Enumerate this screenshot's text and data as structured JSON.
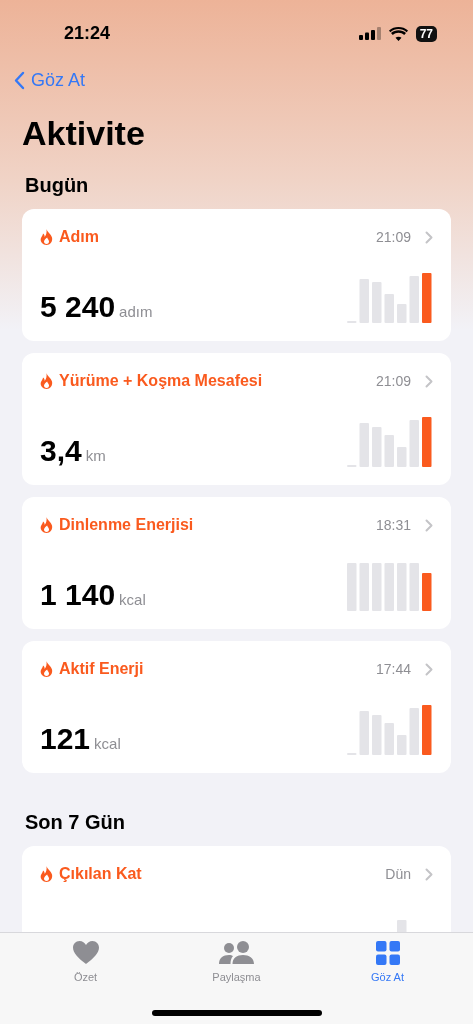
{
  "status_bar": {
    "time": "21:24",
    "battery": "77"
  },
  "nav": {
    "back": "Göz At",
    "title": "Aktivite"
  },
  "sections": [
    {
      "title": "Bugün",
      "cards": [
        {
          "title": "Adım",
          "time": "21:09",
          "value": "5 240",
          "unit": "adım"
        },
        {
          "title": "Yürüme + Koşma Mesafesi",
          "time": "21:09",
          "value": "3,4",
          "unit": "km"
        },
        {
          "title": "Dinlenme Enerjisi",
          "time": "18:31",
          "value": "1 140",
          "unit": "kcal"
        },
        {
          "title": "Aktif Enerji",
          "time": "17:44",
          "value": "121",
          "unit": "kcal"
        }
      ]
    },
    {
      "title": "Son 7 Gün",
      "cards": [
        {
          "title": "Çıkılan Kat",
          "time": "Dün"
        }
      ]
    }
  ],
  "tab_bar": [
    {
      "label": "Özet",
      "selected": false
    },
    {
      "label": "Paylaşma",
      "selected": false
    },
    {
      "label": "Göz At",
      "selected": true
    }
  ]
}
